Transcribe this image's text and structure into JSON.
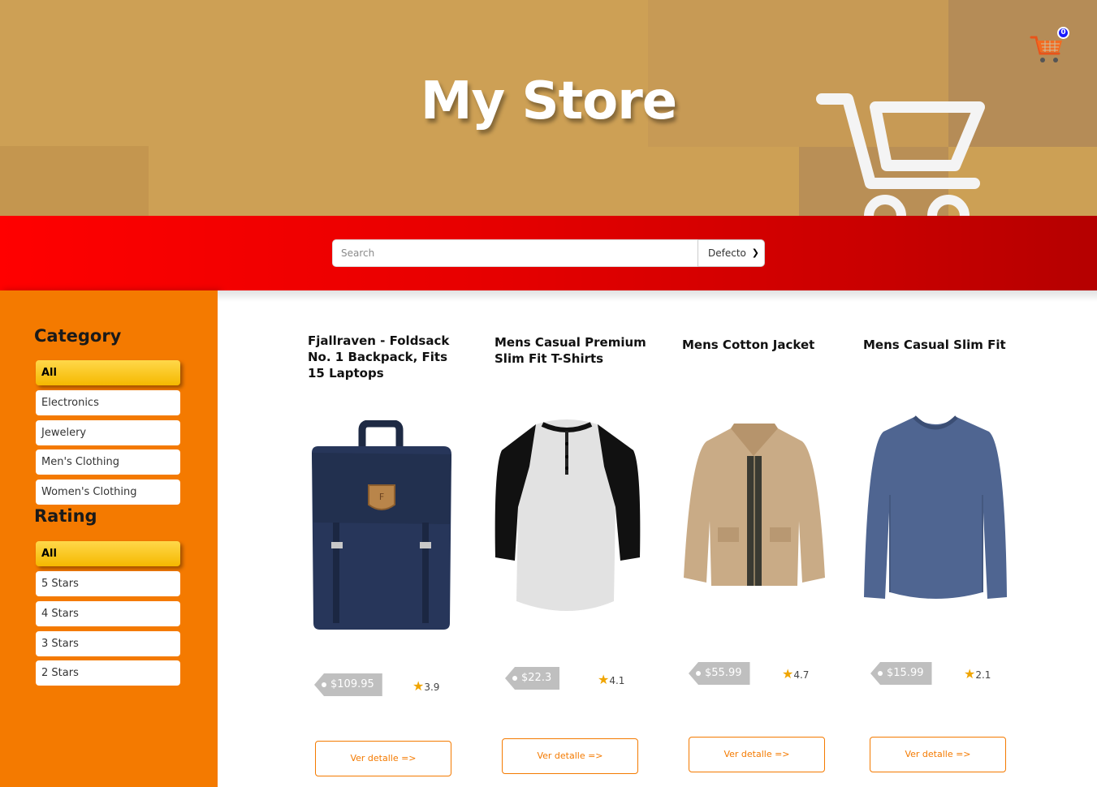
{
  "header": {
    "title": "My Store",
    "cart_count": "0",
    "colors": {
      "background": "#cda055",
      "accent": "#f47a00"
    }
  },
  "search": {
    "placeholder": "Search",
    "value": "",
    "sort_selected": "Defecto"
  },
  "sidebar": {
    "category_heading": "Category",
    "categories": [
      {
        "label": "All",
        "active": true
      },
      {
        "label": "Electronics",
        "active": false
      },
      {
        "label": "Jewelery",
        "active": false
      },
      {
        "label": "Men's Clothing",
        "active": false
      },
      {
        "label": "Women's Clothing",
        "active": false
      }
    ],
    "rating_heading": "Rating",
    "ratings": [
      {
        "label": "All",
        "active": true
      },
      {
        "label": "5 Stars",
        "active": false
      },
      {
        "label": "4 Stars",
        "active": false
      },
      {
        "label": "3 Stars",
        "active": false
      },
      {
        "label": "2 Stars",
        "active": false
      }
    ]
  },
  "products": [
    {
      "title": "Fjallraven - Foldsack No. 1 Backpack, Fits 15 Laptops",
      "price": "$109.95",
      "rating": "3.9",
      "button": "Ver detalle =>",
      "image": "backpack"
    },
    {
      "title": "Mens Casual Premium Slim Fit T-Shirts",
      "price": "$22.3",
      "rating": "4.1",
      "button": "Ver detalle =>",
      "image": "raglan-shirt"
    },
    {
      "title": "Mens Cotton Jacket",
      "price": "$55.99",
      "rating": "4.7",
      "button": "Ver detalle =>",
      "image": "jacket"
    },
    {
      "title": "Mens Casual Slim Fit",
      "price": "$15.99",
      "rating": "2.1",
      "button": "Ver detalle =>",
      "image": "longsleeve-shirt"
    }
  ]
}
